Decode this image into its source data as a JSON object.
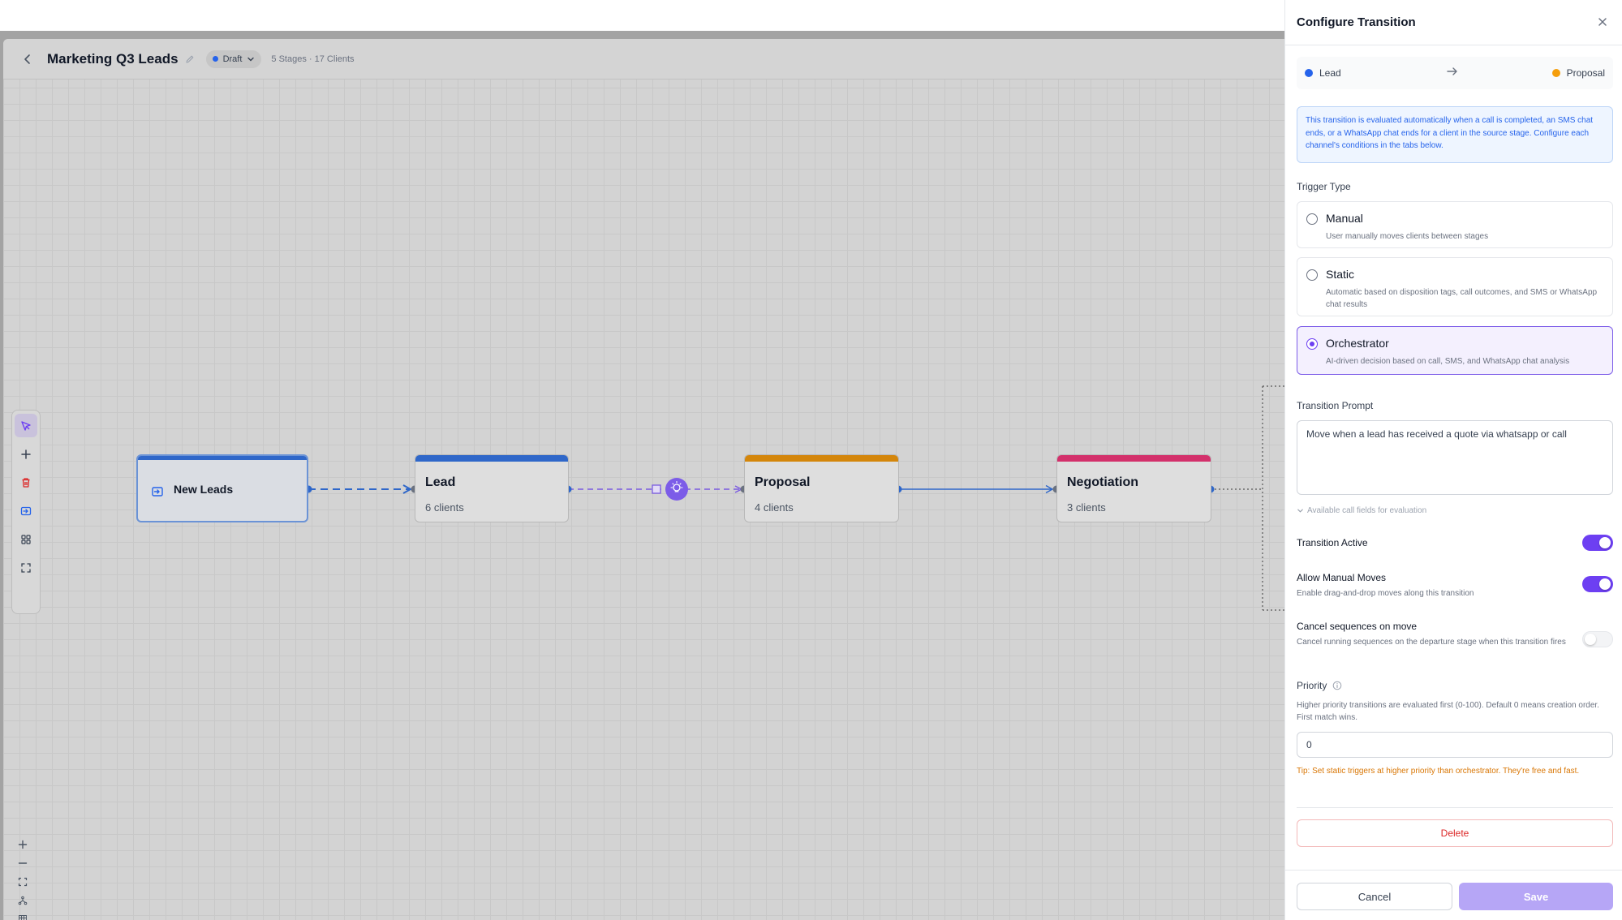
{
  "editor": {
    "title": "Marketing Q3 Leads",
    "status": "Draft",
    "meta": "5 Stages · 17 Clients"
  },
  "nodes": {
    "source": {
      "title": "New Leads"
    },
    "stages": [
      {
        "title": "Lead",
        "count": "6 clients",
        "color": "#2f67c9"
      },
      {
        "title": "Proposal",
        "count": "4 clients",
        "color": "#d4860b"
      },
      {
        "title": "Negotiation",
        "count": "3 clients",
        "color": "#d3306b"
      }
    ]
  },
  "panel": {
    "title": "Configure Transition",
    "from_stage": "Lead",
    "from_color": "#2563eb",
    "to_stage": "Proposal",
    "to_color": "#f59e0b",
    "info": "This transition is evaluated automatically when a call is completed, an SMS chat ends, or a WhatsApp chat ends for a client in the source stage. Configure each channel's conditions in the tabs below.",
    "trigger_type_label": "Trigger Type",
    "options": [
      {
        "title": "Manual",
        "desc": "User manually moves clients between stages"
      },
      {
        "title": "Static",
        "desc": "Automatic based on disposition tags, call outcomes, and SMS or WhatsApp chat results"
      },
      {
        "title": "Orchestrator",
        "desc": "AI-driven decision based on call, SMS, and WhatsApp chat analysis"
      }
    ],
    "selected_option": "Orchestrator",
    "prompt_label": "Transition Prompt",
    "prompt_value": "Move when a lead has received a quote via whatsapp or call",
    "fields_toggle": "Available call fields for evaluation",
    "transition_active": {
      "label": "Transition Active",
      "on": true
    },
    "allow_manual": {
      "label": "Allow Manual Moves",
      "desc": "Enable drag-and-drop moves along this transition",
      "on": true
    },
    "cancel_sequences": {
      "label": "Cancel sequences on move",
      "desc": "Cancel running sequences on the departure stage when this transition fires",
      "on": false
    },
    "priority_label": "Priority",
    "priority_desc": "Higher priority transitions are evaluated first (0-100). Default 0 means creation order. First match wins.",
    "priority_value": "0",
    "tip": "Tip: Set static triggers at higher priority than orchestrator. They're free and fast.",
    "delete_label": "Delete",
    "cancel_label": "Cancel",
    "save_label": "Save"
  },
  "colors": {
    "accent": "#6d3ff2",
    "danger": "#dc2626",
    "info": "#2563eb",
    "warning": "#d97706"
  }
}
